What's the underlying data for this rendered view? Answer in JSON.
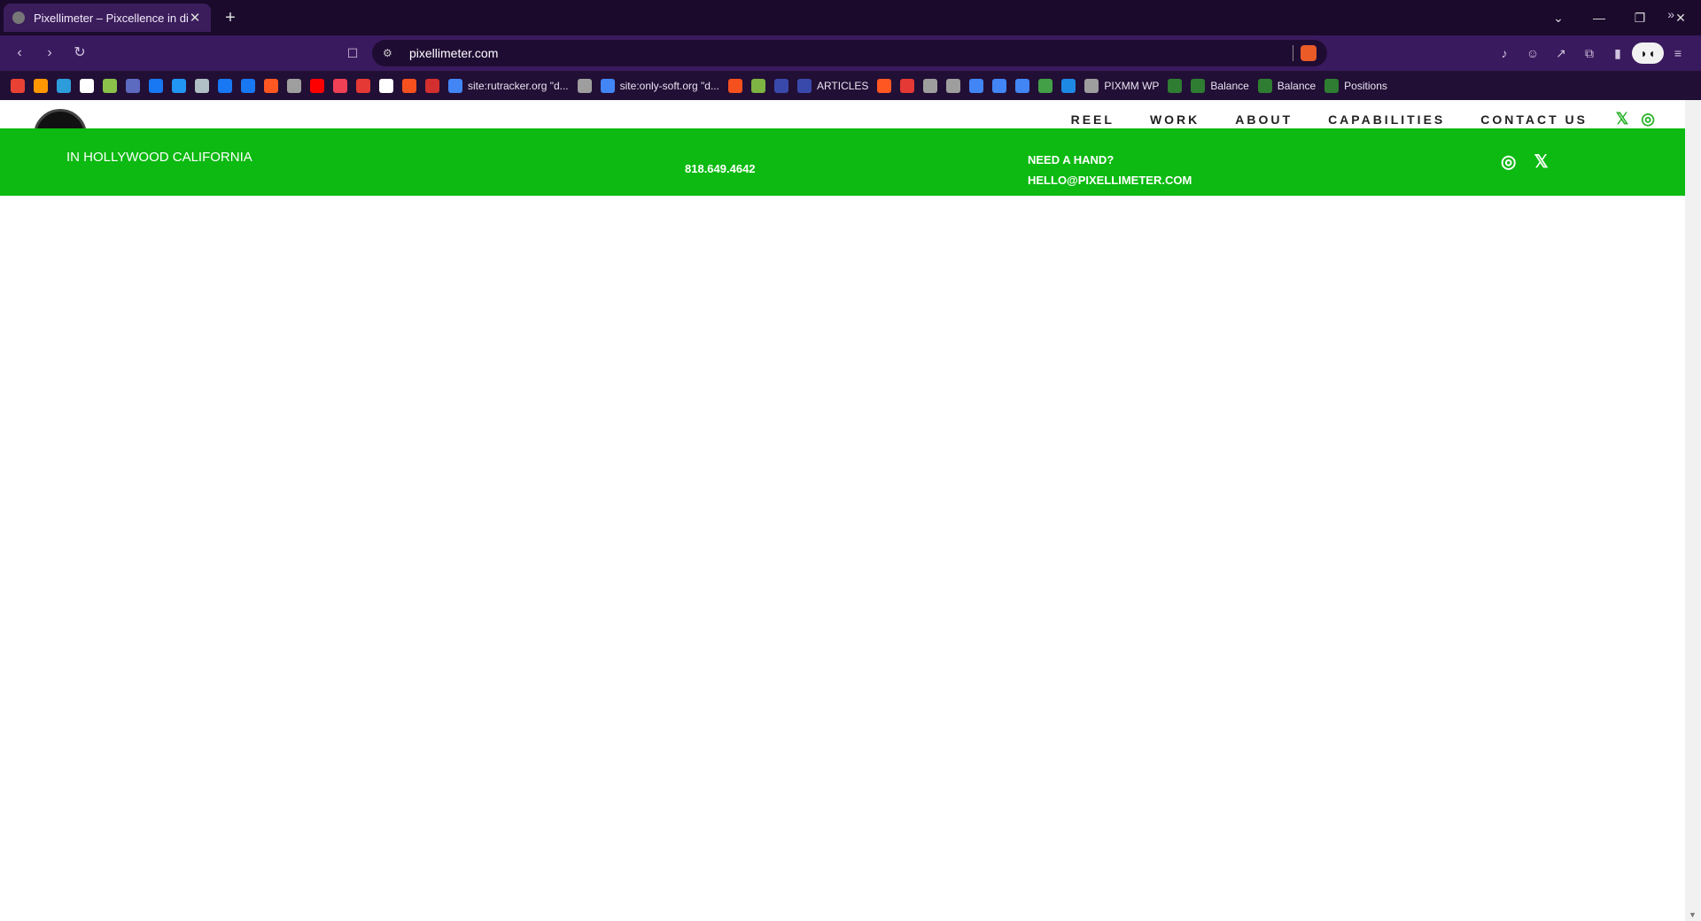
{
  "browser": {
    "tab_title": "Pixellimeter – Pixcellence in digi",
    "tab_close": "✕",
    "new_tab": "+",
    "url": "pixellimeter.com",
    "bookmarks": [
      {
        "icon": "gmail-icon",
        "color": "#e94235",
        "label": ""
      },
      {
        "icon": "apps-grid-icon",
        "color": "#ff9800",
        "label": ""
      },
      {
        "icon": "cloud-icon",
        "color": "#2d9cdb",
        "label": ""
      },
      {
        "icon": "amazon-icon",
        "color": "#ffffff",
        "label": ""
      },
      {
        "icon": "bars-icon",
        "color": "#8bc34a",
        "label": ""
      },
      {
        "icon": "bookmark-m-icon",
        "color": "#5c6bc0",
        "label": ""
      },
      {
        "icon": "facebook-icon",
        "color": "#1877f2",
        "label": ""
      },
      {
        "icon": "chat-icon",
        "color": "#2196f3",
        "label": ""
      },
      {
        "icon": "printer-icon",
        "color": "#b0bec5",
        "label": ""
      },
      {
        "icon": "facebook-icon",
        "color": "#1877f2",
        "label": ""
      },
      {
        "icon": "facebook-icon",
        "color": "#1877f2",
        "label": ""
      },
      {
        "icon": "color-wheel-icon",
        "color": "#ff5722",
        "label": ""
      },
      {
        "icon": "globe-icon",
        "color": "#9e9e9e",
        "label": ""
      },
      {
        "icon": "youtube-icon",
        "color": "#ff0000",
        "label": ""
      },
      {
        "icon": "pocket-icon",
        "color": "#ef4056",
        "label": ""
      },
      {
        "icon": "link-icon",
        "color": "#e53935",
        "label": ""
      },
      {
        "icon": "chart-icon",
        "color": "#ffffff",
        "label": ""
      },
      {
        "icon": "swirl-icon",
        "color": "#f4511e",
        "label": ""
      },
      {
        "icon": "ek-icon",
        "color": "#d32f2f",
        "label": ""
      },
      {
        "icon": "google-icon",
        "color": "#4285f4",
        "label": "site:rutracker.org \"d..."
      },
      {
        "icon": "globe-icon",
        "color": "#9e9e9e",
        "label": ""
      },
      {
        "icon": "google-icon",
        "color": "#4285f4",
        "label": "site:only-soft.org \"d..."
      },
      {
        "icon": "swirl-icon",
        "color": "#f4511e",
        "label": ""
      },
      {
        "icon": "fa-icon",
        "color": "#7cb342",
        "label": ""
      },
      {
        "icon": "dot-icon",
        "color": "#3949ab",
        "label": ""
      },
      {
        "icon": "dot-icon",
        "color": "#3949ab",
        "label": "ARTICLES"
      },
      {
        "icon": "color-wheel-icon",
        "color": "#ff5722",
        "label": ""
      },
      {
        "icon": "mt-icon",
        "color": "#e53935",
        "label": ""
      },
      {
        "icon": "doc-icon",
        "color": "#9e9e9e",
        "label": ""
      },
      {
        "icon": "doc-icon",
        "color": "#9e9e9e",
        "label": ""
      },
      {
        "icon": "google-icon",
        "color": "#4285f4",
        "label": ""
      },
      {
        "icon": "google-icon",
        "color": "#4285f4",
        "label": ""
      },
      {
        "icon": "google-icon",
        "color": "#4285f4",
        "label": ""
      },
      {
        "icon": "t-icon",
        "color": "#43a047",
        "label": ""
      },
      {
        "icon": "ha-icon",
        "color": "#1e88e5",
        "label": ""
      },
      {
        "icon": "globe-icon",
        "color": "#9e9e9e",
        "label": "PIXMM WP"
      },
      {
        "icon": "td-icon",
        "color": "#2e7d32",
        "label": ""
      },
      {
        "icon": "td-icon",
        "color": "#2e7d32",
        "label": "Balance"
      },
      {
        "icon": "td-icon",
        "color": "#2e7d32",
        "label": "Balance"
      },
      {
        "icon": "td-icon",
        "color": "#2e7d32",
        "label": "Positions"
      }
    ]
  },
  "site": {
    "nav": [
      "REEL",
      "WORK",
      "ABOUT",
      "CAPABILITIES",
      "CONTACT US"
    ],
    "nav_social": [
      "𝕏",
      "◎"
    ],
    "location": "IN HOLLYWOOD CALIFORNIA",
    "phone": "818.649.4642",
    "contact_heading": "NEED A HAND?",
    "email": "HELLO@PIXELLIMETER.COM",
    "green_social": [
      "◎",
      "𝕏"
    ]
  },
  "colors": {
    "brand_green": "#0cba11",
    "nav_icon_green": "#27b227",
    "browser_bg": "#220f35"
  }
}
